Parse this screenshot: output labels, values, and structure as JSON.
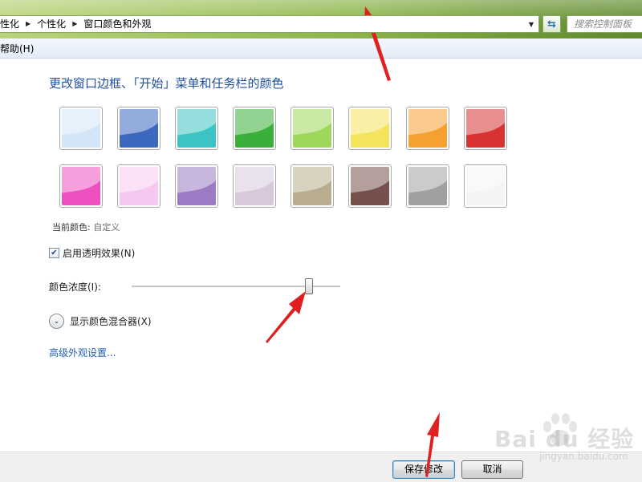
{
  "breadcrumb": {
    "items": [
      "性化",
      "个性化",
      "窗口颜色和外观"
    ]
  },
  "search": {
    "placeholder": "搜索控制面板"
  },
  "menu": {
    "help": "帮助(H)"
  },
  "content": {
    "heading": "更改窗口边框、「开始」菜单和任务栏的颜色",
    "current_color_label": "当前颜色:",
    "current_color_value": "自定义",
    "transparency_label": "启用透明效果(N)",
    "transparency_checked": true,
    "intensity_label": "颜色浓度(I):",
    "intensity_value_fraction": 0.85,
    "mixer_label": "显示颜色混合器(X)",
    "advanced_link": "高级外观设置..."
  },
  "swatches": [
    {
      "name": "sky",
      "color": "#d3e6f7"
    },
    {
      "name": "twilight",
      "color": "#3c68c0"
    },
    {
      "name": "sea",
      "color": "#3cc4c4"
    },
    {
      "name": "leaf",
      "color": "#3ab03a"
    },
    {
      "name": "lime",
      "color": "#9ed85a"
    },
    {
      "name": "sun",
      "color": "#f6e35c"
    },
    {
      "name": "pumpkin",
      "color": "#f6a030"
    },
    {
      "name": "ruby",
      "color": "#d83232"
    },
    {
      "name": "fuchsia",
      "color": "#ee50c0"
    },
    {
      "name": "blush",
      "color": "#f7c8ef"
    },
    {
      "name": "violet",
      "color": "#9a7bc4"
    },
    {
      "name": "lavender",
      "color": "#d8c8dc"
    },
    {
      "name": "taupe",
      "color": "#b8ad8e"
    },
    {
      "name": "chocolate",
      "color": "#75504c"
    },
    {
      "name": "slate",
      "color": "#a0a0a0"
    },
    {
      "name": "frost",
      "color": "#f4f4f4"
    }
  ],
  "buttons": {
    "save": "保存修改",
    "cancel": "取消"
  },
  "watermark": {
    "text": "Bai du 经验",
    "sub": "jingyan.baidu.com"
  },
  "colors": {
    "heading": "#1f4fa0",
    "link": "#1f5fb8",
    "arrow": "#e02020"
  }
}
